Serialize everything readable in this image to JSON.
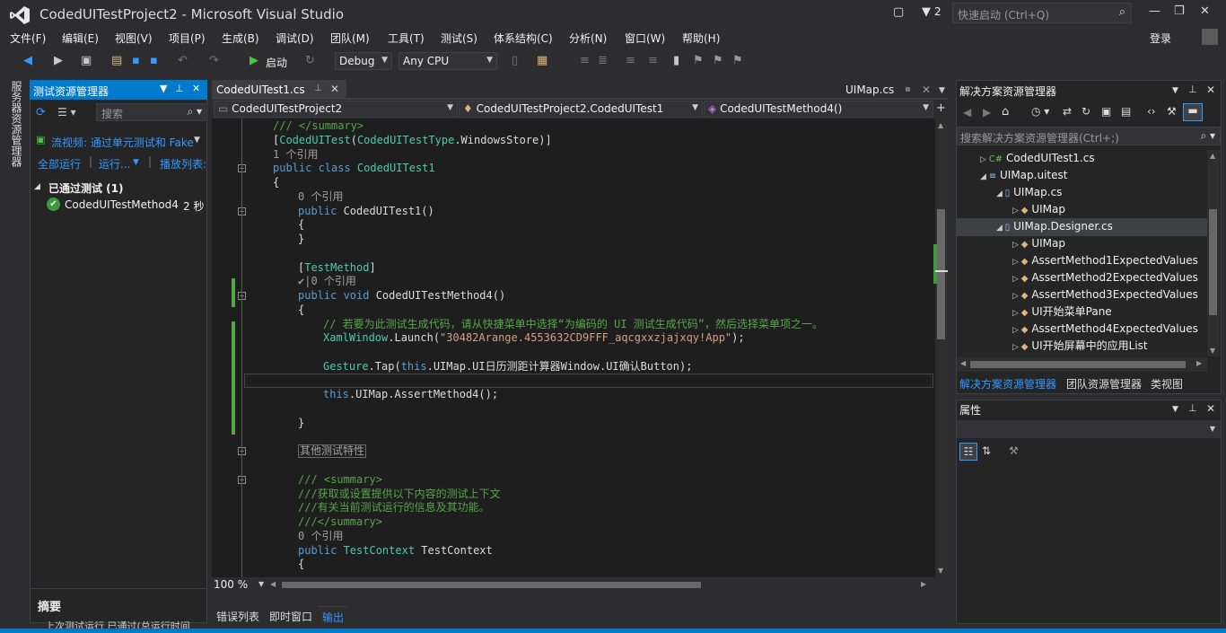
{
  "window": {
    "title": "CodedUITestProject2 - Microsoft Visual Studio",
    "notifications": "2",
    "quick_launch": "快速启动 (Ctrl+Q)",
    "signin": "登录"
  },
  "menu": [
    "文件(F)",
    "编辑(E)",
    "视图(V)",
    "项目(P)",
    "生成(B)",
    "调试(D)",
    "团队(M)",
    "工具(T)",
    "测试(S)",
    "体系结构(C)",
    "分析(N)",
    "窗口(W)",
    "帮助(H)"
  ],
  "toolbar": {
    "start": "启动",
    "config": "Debug",
    "platform": "Any CPU"
  },
  "leftstrip": {
    "label": "服务器资源管理器"
  },
  "test_explorer": {
    "title": "测试资源管理器",
    "search_placeholder": "搜索",
    "playlist": "流视频: 通过单元测试和 Fake",
    "run_all": "全部运行",
    "run": "运行...",
    "playlist_label": "播放列表:",
    "group": "已通过测试 (1)",
    "test_name": "CodedUITestMethod4",
    "test_time": "2 秒",
    "summary": "摘要",
    "summary_text": "上次测试运行 已通过(总运行时间"
  },
  "editor": {
    "tab_active": "CodedUITest1.cs",
    "tab_right": "UIMap.cs",
    "nav_project": "CodedUITestProject2",
    "nav_class": "CodedUITestProject2.CodedUITest1",
    "nav_member": "CodedUITestMethod4()",
    "zoom": "100 %",
    "lines": [
      {
        "i": 0,
        "t": [
          [
            "cm",
            "/// </summary>"
          ]
        ]
      },
      {
        "i": 0,
        "t": [
          [
            "pl",
            "["
          ],
          [
            "ty",
            "CodedUITest"
          ],
          [
            "pl",
            "("
          ],
          [
            "ty",
            "CodedUITestType"
          ],
          [
            "pl",
            ".WindowsStore)]"
          ]
        ]
      },
      {
        "i": 0,
        "t": [
          [
            "ref",
            "1 个引用"
          ]
        ]
      },
      {
        "i": 0,
        "t": [
          [
            "kw",
            "public class "
          ],
          [
            "ty",
            "CodedUITest1"
          ]
        ]
      },
      {
        "i": 0,
        "t": [
          [
            "pl",
            "{"
          ]
        ]
      },
      {
        "i": 1,
        "t": [
          [
            "ref",
            "0 个引用"
          ]
        ]
      },
      {
        "i": 1,
        "t": [
          [
            "kw",
            "public "
          ],
          [
            "pl",
            "CodedUITest1()"
          ]
        ]
      },
      {
        "i": 1,
        "t": [
          [
            "pl",
            "{"
          ]
        ]
      },
      {
        "i": 1,
        "t": [
          [
            "pl",
            "}"
          ]
        ]
      },
      {
        "i": 1,
        "t": []
      },
      {
        "i": 1,
        "t": [
          [
            "pl",
            "["
          ],
          [
            "ty",
            "TestMethod"
          ],
          [
            "pl",
            "]"
          ]
        ]
      },
      {
        "i": 1,
        "t": [
          [
            "ref",
            "✔|0 个引用"
          ]
        ]
      },
      {
        "i": 1,
        "t": [
          [
            "kw",
            "public void "
          ],
          [
            "pl",
            "CodedUITestMethod4()"
          ]
        ]
      },
      {
        "i": 1,
        "t": [
          [
            "pl",
            "{"
          ]
        ]
      },
      {
        "i": 2,
        "t": [
          [
            "cm",
            "// 若要为此测试生成代码，请从快捷菜单中选择“为编码的 UI 测试生成代码”，然后选择菜单项之一。"
          ]
        ]
      },
      {
        "i": 2,
        "t": [
          [
            "ty",
            "XamlWindow"
          ],
          [
            "pl",
            ".Launch("
          ],
          [
            "st",
            "\"30482Arange.4553632CD9FFF_aqcgxxzjajxqy!App\""
          ],
          [
            "pl",
            ");"
          ]
        ]
      },
      {
        "i": 2,
        "t": []
      },
      {
        "i": 2,
        "t": [
          [
            "ty",
            "Gesture"
          ],
          [
            "pl",
            ".Tap("
          ],
          [
            "kw",
            "this"
          ],
          [
            "pl",
            ".UIMap.UI日历测距计算器Window.UI确认Button);"
          ]
        ]
      },
      {
        "i": 2,
        "t": []
      },
      {
        "i": 2,
        "t": [
          [
            "kw",
            "this"
          ],
          [
            "pl",
            ".UIMap.AssertMethod4();"
          ]
        ]
      },
      {
        "i": 2,
        "t": []
      },
      {
        "i": 1,
        "t": [
          [
            "pl",
            "}"
          ]
        ]
      },
      {
        "i": 1,
        "t": []
      },
      {
        "i": 1,
        "t": [
          [
            "ref",
            "其他测试特性"
          ]
        ]
      },
      {
        "i": 1,
        "t": []
      },
      {
        "i": 1,
        "t": [
          [
            "cm",
            "/// <summary>"
          ]
        ]
      },
      {
        "i": 1,
        "t": [
          [
            "cm",
            "///获取或设置提供以下内容的测试上下文"
          ]
        ]
      },
      {
        "i": 1,
        "t": [
          [
            "cm",
            "///有关当前测试运行的信息及其功能。"
          ]
        ]
      },
      {
        "i": 1,
        "t": [
          [
            "cm",
            "///</summary>"
          ]
        ]
      },
      {
        "i": 1,
        "t": [
          [
            "ref",
            "0 个引用"
          ]
        ]
      },
      {
        "i": 1,
        "t": [
          [
            "kw",
            "public "
          ],
          [
            "ty",
            "TestContext"
          ],
          [
            "pl",
            " TestContext"
          ]
        ]
      },
      {
        "i": 1,
        "t": [
          [
            "pl",
            "{"
          ]
        ]
      }
    ]
  },
  "output_tabs": [
    "错误列表",
    "即时窗口",
    "输出"
  ],
  "solution_explorer": {
    "title": "解决方案资源管理器",
    "search_placeholder": "搜索解决方案资源管理器(Ctrl+;)",
    "items": [
      {
        "indent": 0,
        "icon": "C#",
        "label": "CodedUITest1.cs"
      },
      {
        "indent": 0,
        "icon": "≡",
        "label": "UIMap.uitest",
        "open": true
      },
      {
        "indent": 1,
        "icon": "▯",
        "label": "UIMap.cs",
        "open": true
      },
      {
        "indent": 2,
        "icon": "◆",
        "label": "UIMap"
      },
      {
        "indent": 1,
        "icon": "▯",
        "label": "UIMap.Designer.cs",
        "open": true
      },
      {
        "indent": 2,
        "icon": "◆",
        "label": "UIMap"
      },
      {
        "indent": 2,
        "icon": "◆",
        "label": "AssertMethod1ExpectedValues"
      },
      {
        "indent": 2,
        "icon": "◆",
        "label": "AssertMethod2ExpectedValues"
      },
      {
        "indent": 2,
        "icon": "◆",
        "label": "AssertMethod3ExpectedValues"
      },
      {
        "indent": 2,
        "icon": "◆",
        "label": "UI开始菜单Pane"
      },
      {
        "indent": 2,
        "icon": "◆",
        "label": "AssertMethod4ExpectedValues"
      },
      {
        "indent": 2,
        "icon": "◆",
        "label": "UI开始屏幕中的应用List"
      }
    ],
    "tabs": [
      "解决方案资源管理器",
      "团队资源管理器",
      "类视图"
    ]
  },
  "properties": {
    "title": "属性"
  }
}
